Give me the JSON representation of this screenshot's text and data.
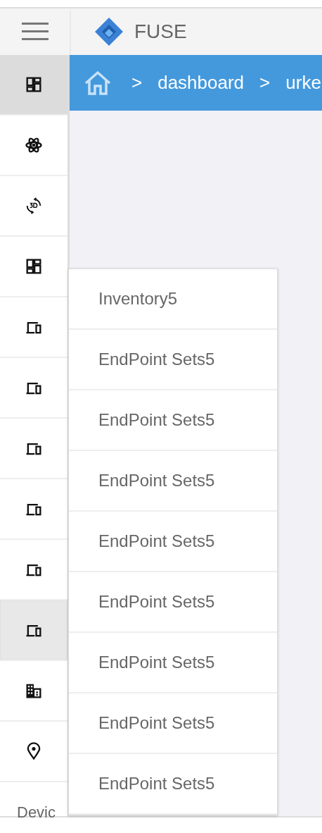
{
  "header": {
    "app_name": "FUSE"
  },
  "sidebar": {
    "items": [
      {
        "kind": "dashboard",
        "selected": true,
        "hovered": false
      },
      {
        "kind": "atom",
        "selected": false,
        "hovered": false
      },
      {
        "kind": "rotate",
        "selected": false,
        "hovered": false
      },
      {
        "kind": "dashboard",
        "selected": false,
        "hovered": false
      },
      {
        "kind": "devices",
        "selected": false,
        "hovered": false
      },
      {
        "kind": "devices",
        "selected": false,
        "hovered": false
      },
      {
        "kind": "devices",
        "selected": false,
        "hovered": false
      },
      {
        "kind": "devices",
        "selected": false,
        "hovered": false
      },
      {
        "kind": "devices",
        "selected": false,
        "hovered": false
      },
      {
        "kind": "devices",
        "selected": false,
        "hovered": true
      },
      {
        "kind": "building",
        "selected": false,
        "hovered": false
      },
      {
        "kind": "pin",
        "selected": false,
        "hovered": false
      }
    ],
    "footer_label": "Devic"
  },
  "breadcrumb": {
    "items": [
      {
        "kind": "home"
      },
      {
        "kind": "separator",
        "text": ">"
      },
      {
        "kind": "link",
        "text": "dashboard"
      },
      {
        "kind": "separator",
        "text": ">"
      },
      {
        "kind": "link",
        "text": "urke"
      }
    ]
  },
  "menu": {
    "items": [
      "Inventory5",
      "EndPoint Sets5",
      "EndPoint Sets5",
      "EndPoint Sets5",
      "EndPoint Sets5",
      "EndPoint Sets5",
      "EndPoint Sets5",
      "EndPoint Sets5",
      "EndPoint Sets5"
    ]
  }
}
